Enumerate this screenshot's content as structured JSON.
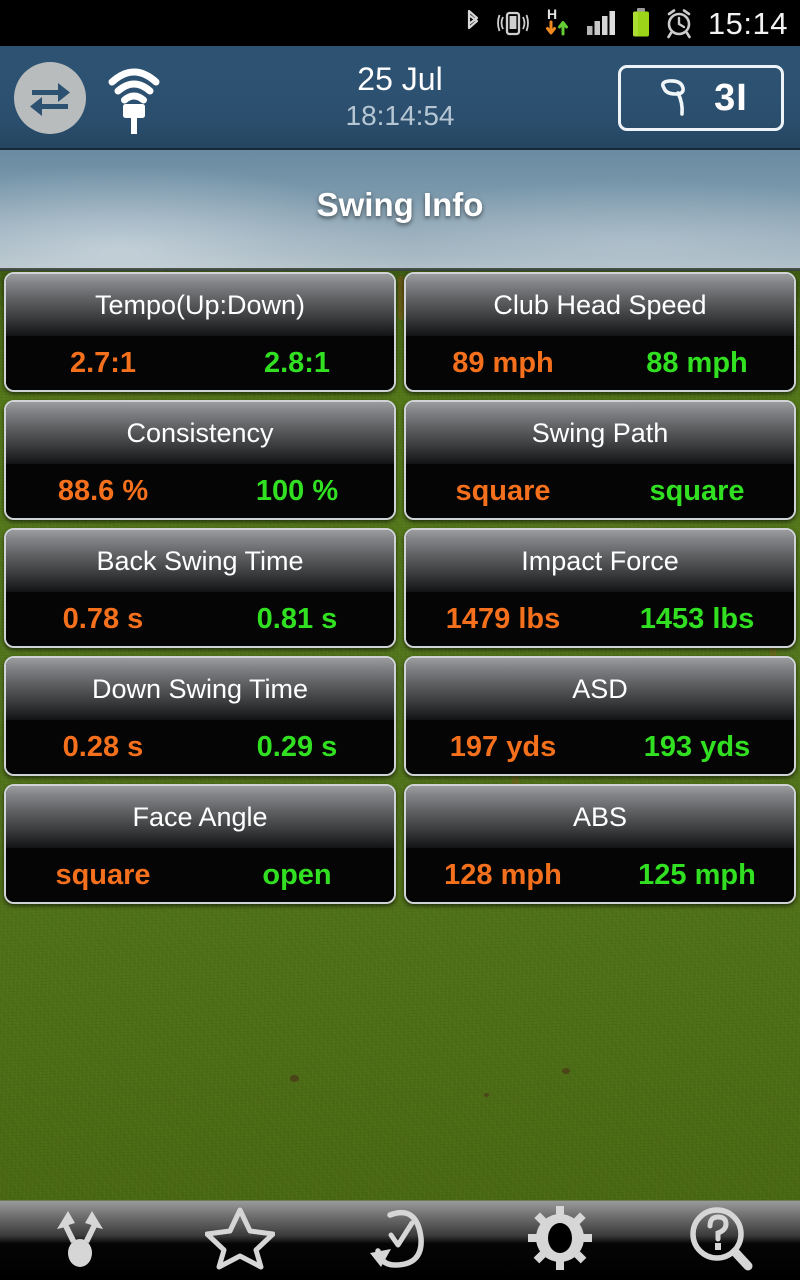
{
  "status_bar": {
    "time": "15:14",
    "icons": [
      {
        "name": "bluetooth-icon",
        "label": "Bluetooth"
      },
      {
        "name": "vibrate-icon",
        "label": "Vibrate"
      },
      {
        "name": "hsdpa-data-icon",
        "label": "H"
      },
      {
        "name": "signal-bars-icon",
        "label": "Signal"
      },
      {
        "name": "battery-icon",
        "label": "Battery"
      },
      {
        "name": "alarm-clock-icon",
        "label": "Alarm"
      }
    ]
  },
  "header": {
    "logo_icon": "sync-arrows-icon",
    "sensor_icon": "wifi-broadcast-icon",
    "date": "25 Jul",
    "time": "18:14:54",
    "club_icon": "golf-club-icon",
    "club": "3I"
  },
  "page": {
    "title": "Swing Info"
  },
  "colors": {
    "value_left": "#f4701c",
    "value_right": "#32e022",
    "header_bg": "#2d5171",
    "card_title": "#ffffff"
  },
  "cards": [
    {
      "title": "Tempo(Up:Down)",
      "left": "2.7:1",
      "right": "2.8:1"
    },
    {
      "title": "Club Head Speed",
      "left": "89 mph",
      "right": "88 mph"
    },
    {
      "title": "Consistency",
      "left": "88.6 %",
      "right": "100 %"
    },
    {
      "title": "Swing Path",
      "left": "square",
      "right": "square"
    },
    {
      "title": "Back Swing Time",
      "left": "0.78 s",
      "right": "0.81 s"
    },
    {
      "title": "Impact Force",
      "left": "1479 lbs",
      "right": "1453 lbs"
    },
    {
      "title": "Down Swing Time",
      "left": "0.28 s",
      "right": "0.29 s"
    },
    {
      "title": "ASD",
      "left": "197 yds",
      "right": "193 yds"
    },
    {
      "title": "Face Angle",
      "left": "square",
      "right": "open"
    },
    {
      "title": "ABS",
      "left": "128 mph",
      "right": "125 mph"
    }
  ],
  "bottom_nav": [
    {
      "name": "swing-compare-icon",
      "label": "Compare"
    },
    {
      "name": "star-favorite-icon",
      "label": "Favorites"
    },
    {
      "name": "history-check-icon",
      "label": "History"
    },
    {
      "name": "gear-settings-icon",
      "label": "Settings"
    },
    {
      "name": "help-search-icon",
      "label": "Help"
    }
  ]
}
